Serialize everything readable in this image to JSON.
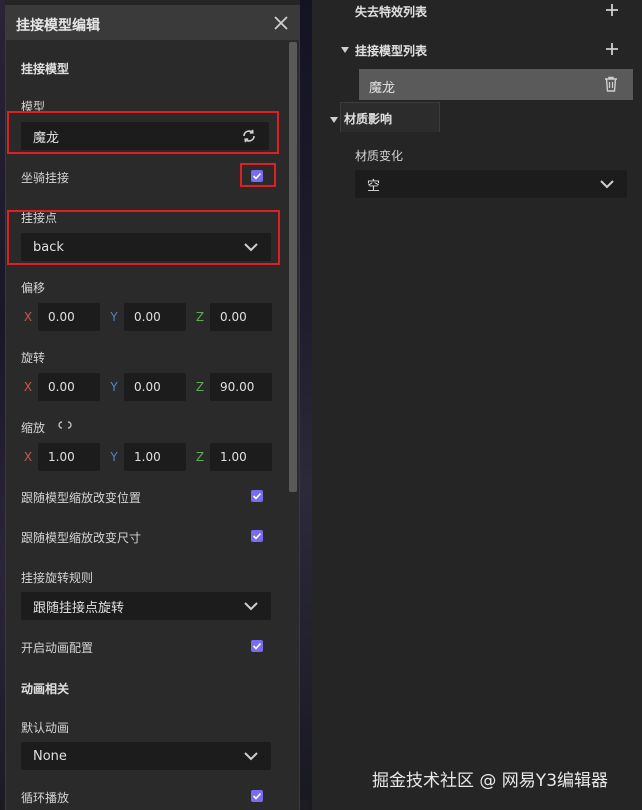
{
  "dialog": {
    "title": "挂接模型编辑",
    "section_main": "挂接模型",
    "model_label": "模型",
    "model_value": "魔龙",
    "mount_label": "坐骑挂接",
    "mount_checked": true,
    "point_label": "挂接点",
    "point_value": "back",
    "offset_label": "偏移",
    "offset": {
      "x": "0.00",
      "y": "0.00",
      "z": "0.00"
    },
    "rotation_label": "旋转",
    "rotation": {
      "x": "0.00",
      "y": "0.00",
      "z": "90.00"
    },
    "scale_label": "缩放",
    "scale": {
      "x": "1.00",
      "y": "1.00",
      "z": "1.00"
    },
    "axis_x": "X",
    "axis_y": "Y",
    "axis_z": "Z",
    "follow_pos_label": "跟随模型缩放改变位置",
    "follow_pos_checked": true,
    "follow_size_label": "跟随模型缩放改变尺寸",
    "follow_size_checked": true,
    "rotate_rule_label": "挂接旋转规则",
    "rotate_rule_value": "跟随挂接点旋转",
    "anim_config_label": "开启动画配置",
    "anim_config_checked": true,
    "section_anim": "动画相关",
    "default_anim_label": "默认动画",
    "default_anim_value": "None",
    "loop_label": "循环播放",
    "loop_checked": true
  },
  "right": {
    "lost_effects_label": "失去特效列表",
    "mount_model_list_label": "挂接模型列表",
    "model_item_label": "魔龙",
    "material_section_label": "材质影响",
    "material_change_label": "材质变化",
    "material_change_value": "空"
  },
  "watermark": "掘金技术社区 @ 网易Y3编辑器",
  "colors": {
    "accent": "#7a6cf0",
    "highlight_box": "#e02020",
    "axis_x": "#c9584f",
    "axis_y": "#4d86c9",
    "axis_z": "#5fab5a"
  }
}
